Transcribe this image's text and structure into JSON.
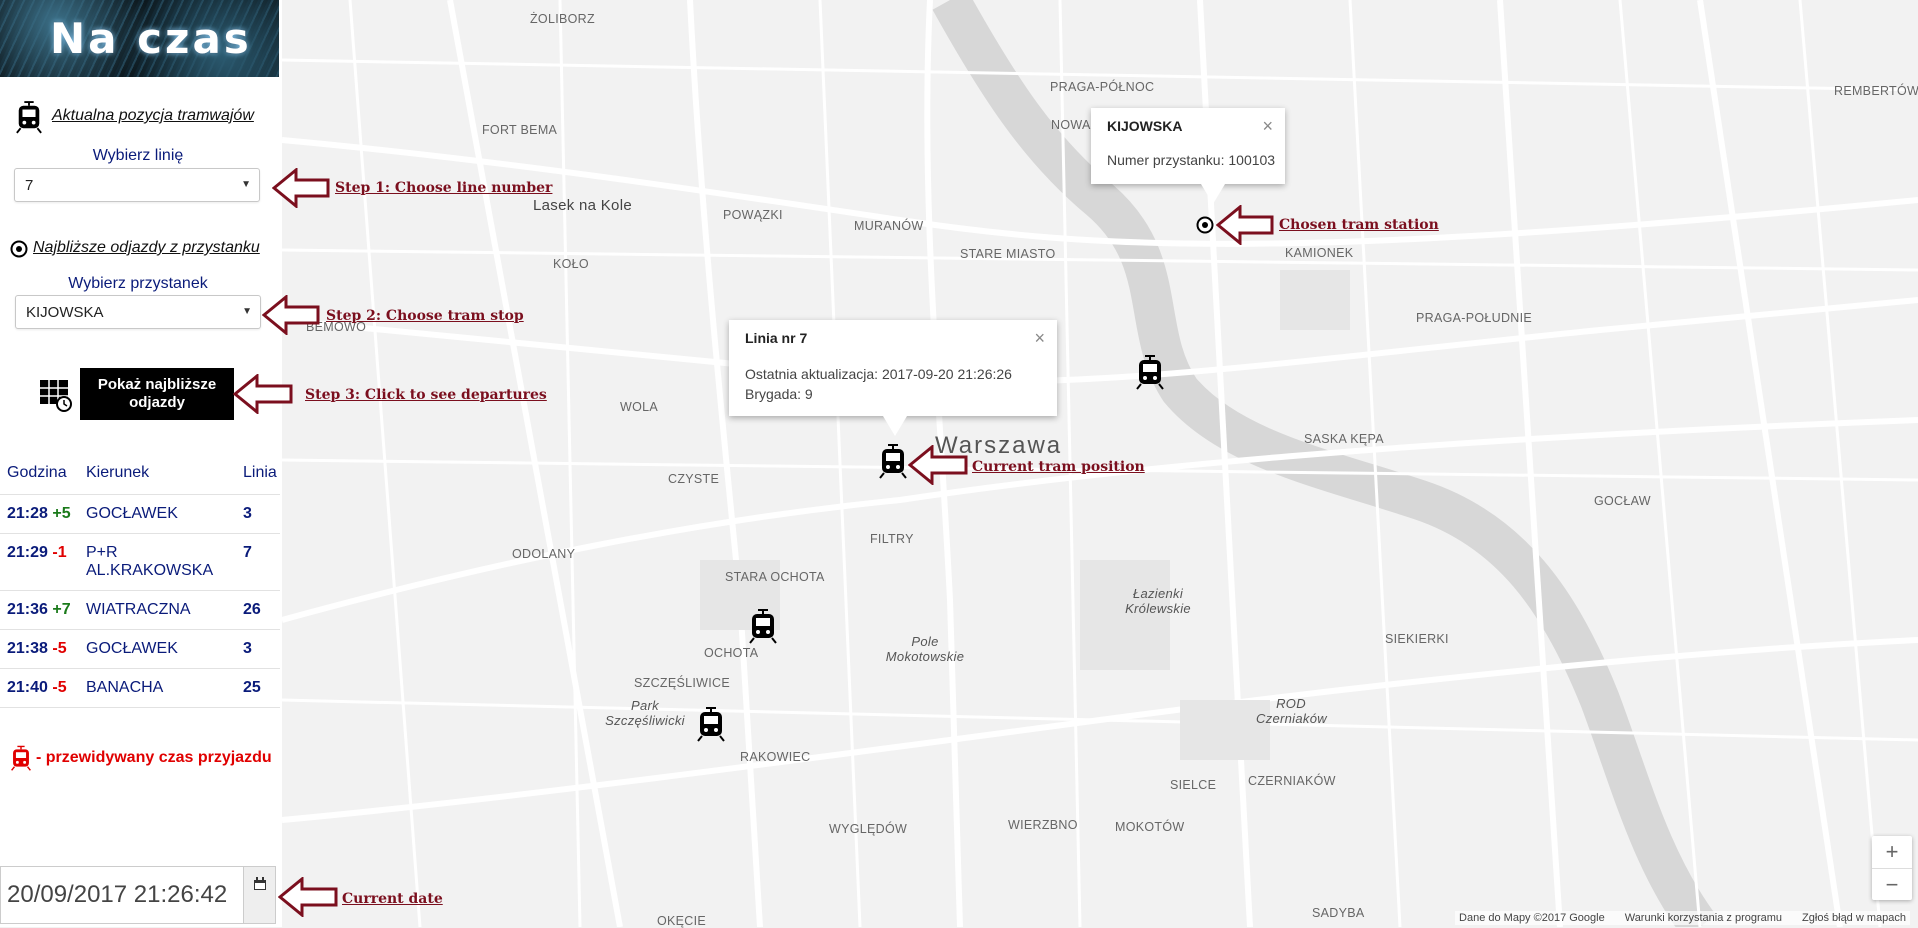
{
  "logo": {
    "text": "Na czas"
  },
  "sidebar": {
    "live_section_label": "Aktualna pozycja tramwajów",
    "line_label": "Wybierz linię",
    "line_value": "7",
    "stop_section_label": "Najbliższe odjazdy z przystanku",
    "stop_label": "Wybierz przystanek",
    "stop_value": "KIJOWSKA",
    "departures_button": "Pokaż najbliższe odjazdy",
    "table": {
      "headers": [
        "Godzina",
        "Kierunek",
        "Linia"
      ],
      "rows": [
        {
          "time": "21:28",
          "delay": "+5",
          "direction": "GOCŁAWEK",
          "line": "3"
        },
        {
          "time": "21:29",
          "delay": "-1",
          "direction": "P+R AL.KRAKOWSKA",
          "line": "7"
        },
        {
          "time": "21:36",
          "delay": "+7",
          "direction": "WIATRACZNA",
          "line": "26"
        },
        {
          "time": "21:38",
          "delay": "-5",
          "direction": "GOCŁAWEK",
          "line": "3"
        },
        {
          "time": "21:40",
          "delay": "-5",
          "direction": "BANACHA",
          "line": "25"
        }
      ]
    },
    "legend": "- przewidywany czas przyjazdu",
    "date_value": "20/09/2017 21:26:42"
  },
  "annotations": {
    "step1": "Step 1: Choose line number",
    "step2": "Step 2: Choose tram stop",
    "step3": "Step 3: Click to see departures",
    "station": "Chosen tram station",
    "position": "Current tram position",
    "date": "Current date"
  },
  "popups": {
    "station": {
      "title": "KIJOWSKA",
      "body": "Numer przystanku: 100103",
      "close": "×"
    },
    "tram": {
      "title": "Linia nr 7",
      "line1": "Ostatnia aktualizacja: 2017-09-20 21:26:26",
      "line2": "Brygada: 9",
      "close": "×"
    }
  },
  "map": {
    "city": "Warszawa",
    "districts": [
      "ŻOLIBORZ",
      "PRAGA-PÓŁNOC",
      "REMBERTÓW",
      "FORT BEMA",
      "NOWA",
      "KIJOWSKA",
      "POWĄZKI",
      "Lasek na Kole",
      "MURANÓW",
      "KOŁO",
      "STARE MIASTO",
      "KAMIONEK",
      "PRAGA-POŁUDNIE",
      "BEMOWO",
      "WOLA",
      "SASKA KĘPA",
      "CZYSTE",
      "GOCŁAW",
      "FILTRY",
      "ODOLANY",
      "STARA OCHOTA",
      "Łazienki Królewskie",
      "SIEKIERKI",
      "OCHOTA",
      "Pole Mokotowskie",
      "SZCZĘŚLIWICE",
      "Park Szczęśliwicki",
      "ROD Czerniaków",
      "RAKOWIEC",
      "SIELCE",
      "CZERNIAKÓW",
      "WYGLĘDÓW",
      "WIERZBNO",
      "MOKOTÓW",
      "SADYBA",
      "OKĘCIE"
    ],
    "attribution": [
      "Dane do Mapy ©2017 Google",
      "Warunki korzystania z programu",
      "Zgłoś błąd w mapach"
    ],
    "zoom_in": "+",
    "zoom_out": "−"
  }
}
